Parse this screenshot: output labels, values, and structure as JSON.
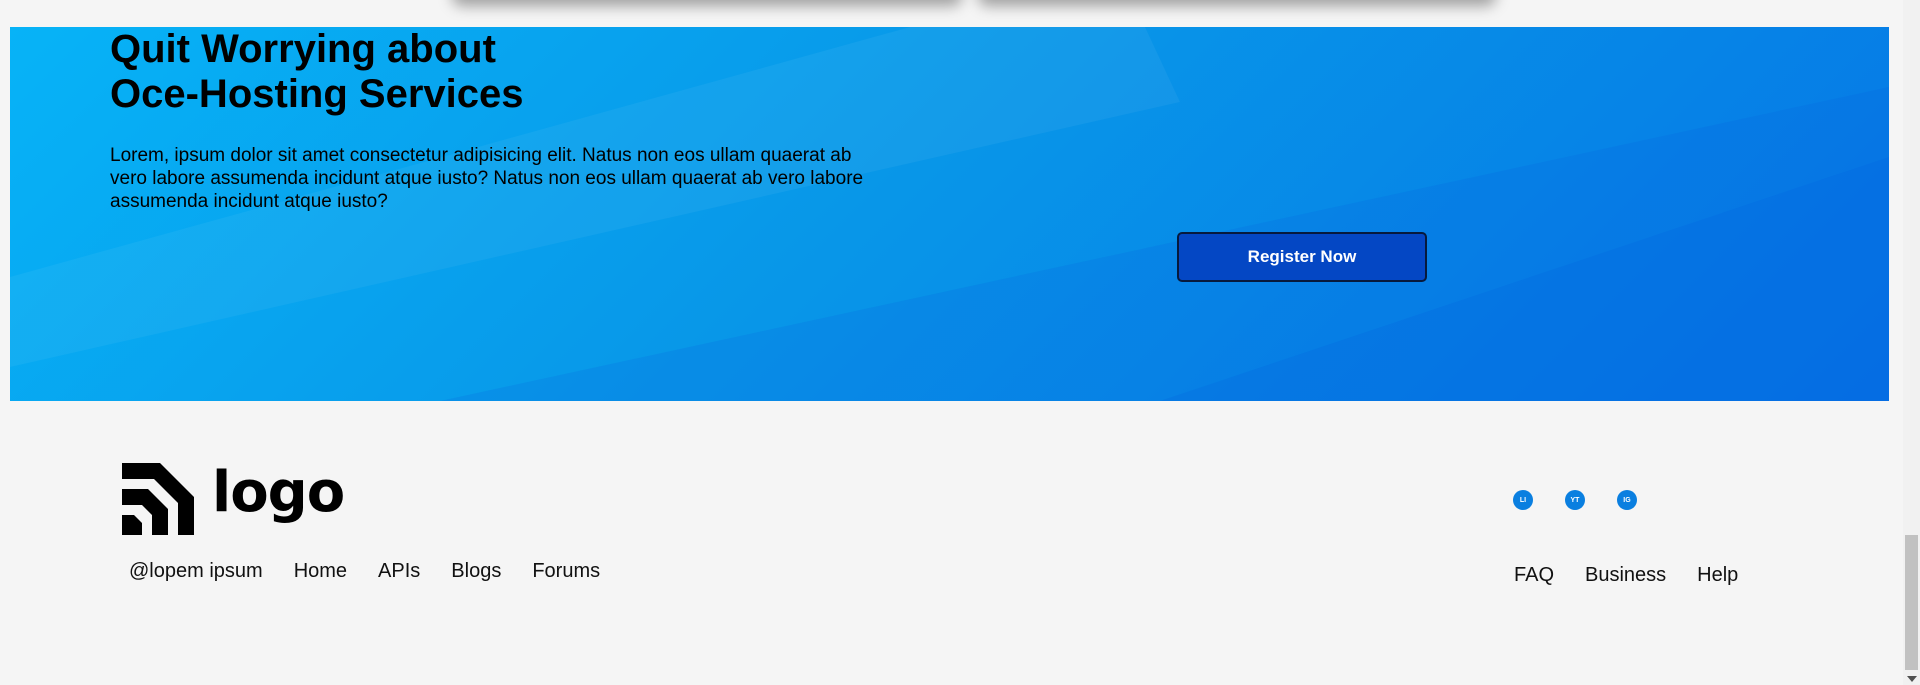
{
  "banner": {
    "title_line1": "Quit Worrying about",
    "title_line2": "Oce-Hosting Services",
    "body": "Lorem, ipsum dolor sit amet consectetur adipisicing elit. Natus non eos ullam quaerat ab vero labore assumenda incidunt atque iusto? Natus non eos ullam quaerat ab vero labore assumenda incidunt atque iusto?",
    "cta_label": "Register Now"
  },
  "footer": {
    "logo_text": "logo",
    "left_links": [
      "@lopem ipsum",
      "Home",
      "APIs",
      "Blogs",
      "Forums"
    ],
    "right_links": [
      "FAQ",
      "Business",
      "Help"
    ],
    "socials": [
      {
        "label": "LI",
        "icon": "linkedin-icon"
      },
      {
        "label": "YT",
        "icon": "youtube-icon"
      },
      {
        "label": "IG",
        "icon": "instagram-icon"
      }
    ]
  },
  "colors": {
    "banner_start": "#07b3f7",
    "banner_end": "#0575e6",
    "button": "#0447c4",
    "page_bg": "#f5f5f5"
  }
}
